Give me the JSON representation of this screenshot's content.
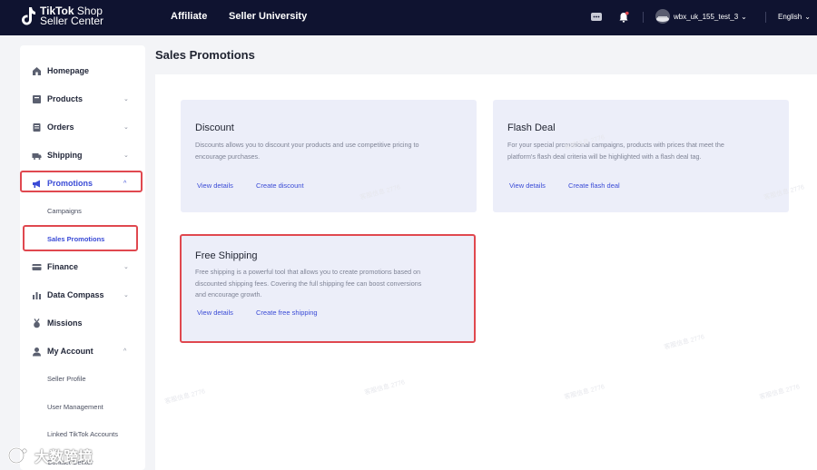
{
  "topbar": {
    "logo_line1_bold": "TikTok",
    "logo_line1_rest": " Shop",
    "logo_line2": "Seller Center",
    "nav": [
      "Affiliate",
      "Seller University"
    ],
    "account_name": "wbx_uk_155_test_3",
    "language": "English"
  },
  "sidebar": {
    "items": [
      {
        "label": "Homepage",
        "icon": "home-icon"
      },
      {
        "label": "Products",
        "icon": "products-icon"
      },
      {
        "label": "Orders",
        "icon": "orders-icon"
      },
      {
        "label": "Shipping",
        "icon": "truck-icon"
      },
      {
        "label": "Promotions",
        "icon": "megaphone-icon"
      },
      {
        "label": "Finance",
        "icon": "card-icon"
      },
      {
        "label": "Data Compass",
        "icon": "chart-icon"
      },
      {
        "label": "Missions",
        "icon": "medal-icon"
      },
      {
        "label": "My Account",
        "icon": "user-icon"
      }
    ],
    "promotions_sub": [
      "Campaigns",
      "Sales Promotions"
    ],
    "account_sub": [
      "Seller Profile",
      "User Management",
      "Linked TikTok Accounts",
      "Contact Center"
    ]
  },
  "main": {
    "title": "Sales Promotions",
    "cards": [
      {
        "title": "Discount",
        "desc": [
          "Discounts allows you to discount your products and use competitive pricing to",
          "encourage purchases."
        ],
        "view": "View details",
        "create": "Create discount"
      },
      {
        "title": "Flash Deal",
        "desc": [
          "For your special promotional campaigns, products with prices that meet the",
          "platform's flash deal criteria will be highlighted with a flash deal tag."
        ],
        "view": "View details",
        "create": "Create flash deal"
      },
      {
        "title": "Free Shipping",
        "desc": [
          "Free shipping is a powerful tool that allows you to create promotions based on",
          "discounted shipping fees. Covering the full shipping fee can boost conversions",
          "and encourage growth."
        ],
        "view": "View details",
        "create": "Create free shipping"
      }
    ]
  },
  "watermark_text": "客服信息 2776",
  "bottom_brand": "大数跨境",
  "colors": {
    "topbar": "#0f1330",
    "accent": "#3a4bd6",
    "highlight": "#e0484f",
    "card": "#eceef9"
  }
}
